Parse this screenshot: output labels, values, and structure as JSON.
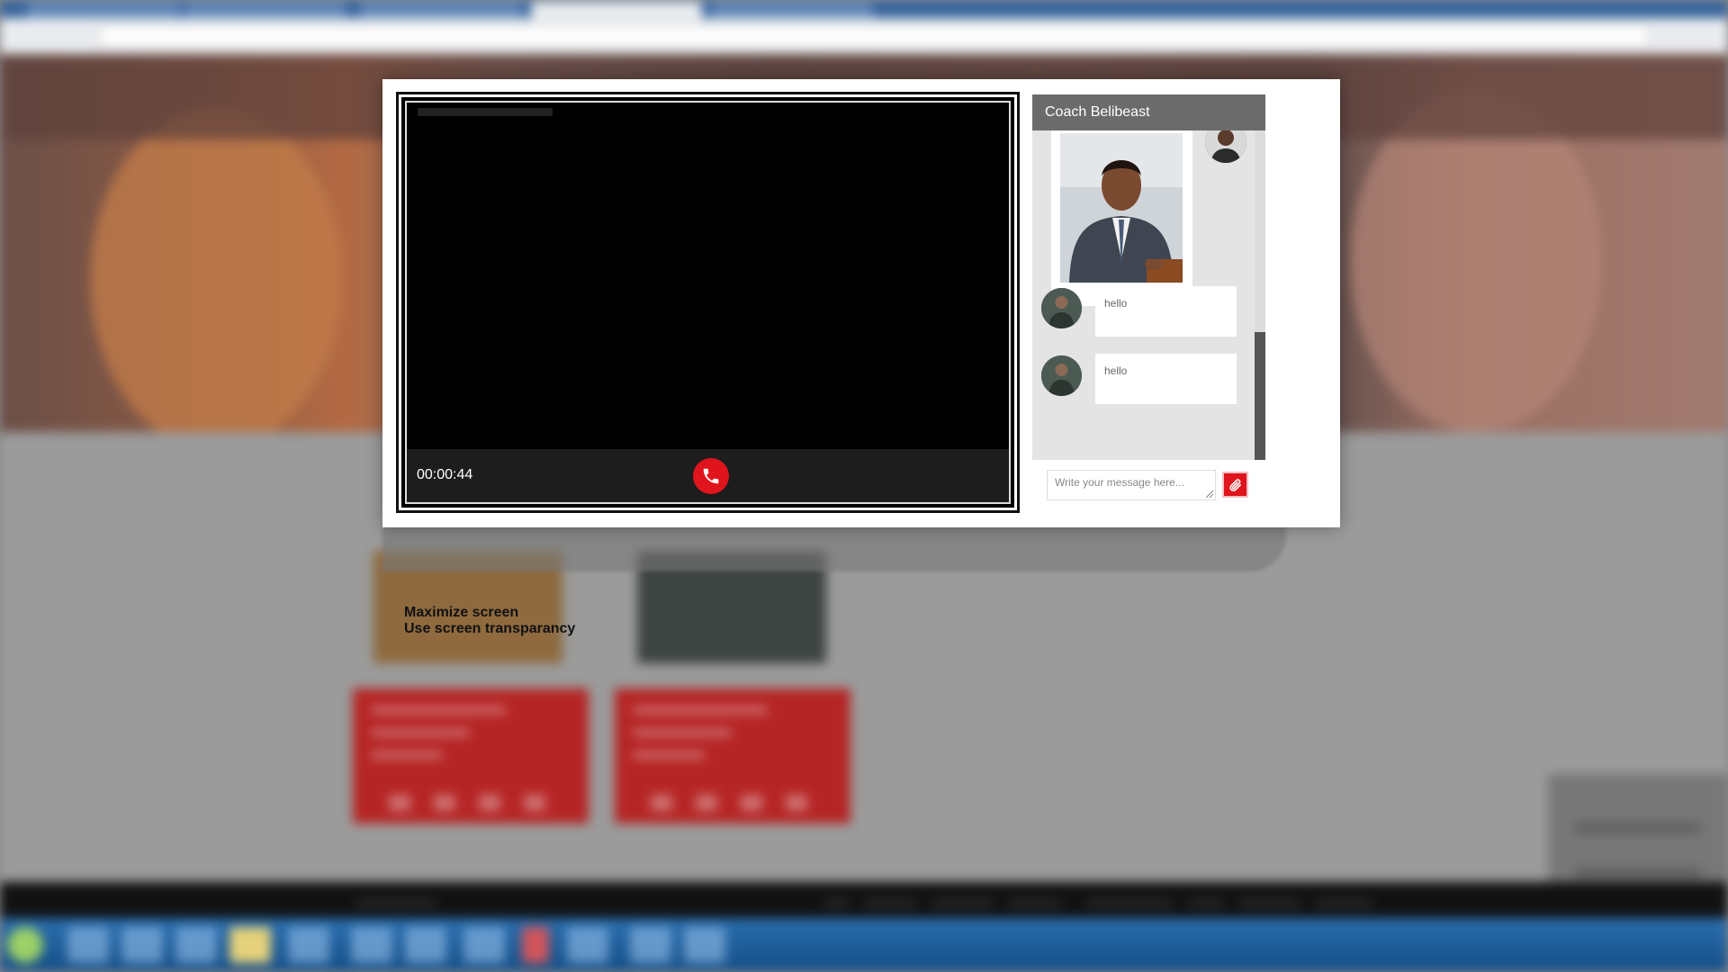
{
  "video_call": {
    "timer": "00:00:44",
    "hangup_icon": "phone-icon",
    "accent_color": "#e0141c"
  },
  "chat": {
    "title": "Coach Belibeast",
    "messages": [
      {
        "text": "hello"
      },
      {
        "text": "hello"
      }
    ],
    "compose_placeholder": "Write your message here...",
    "attach_icon": "paperclip-icon"
  },
  "hint": {
    "line1": "Maximize screen",
    "line2": "Use screen transparancy"
  }
}
